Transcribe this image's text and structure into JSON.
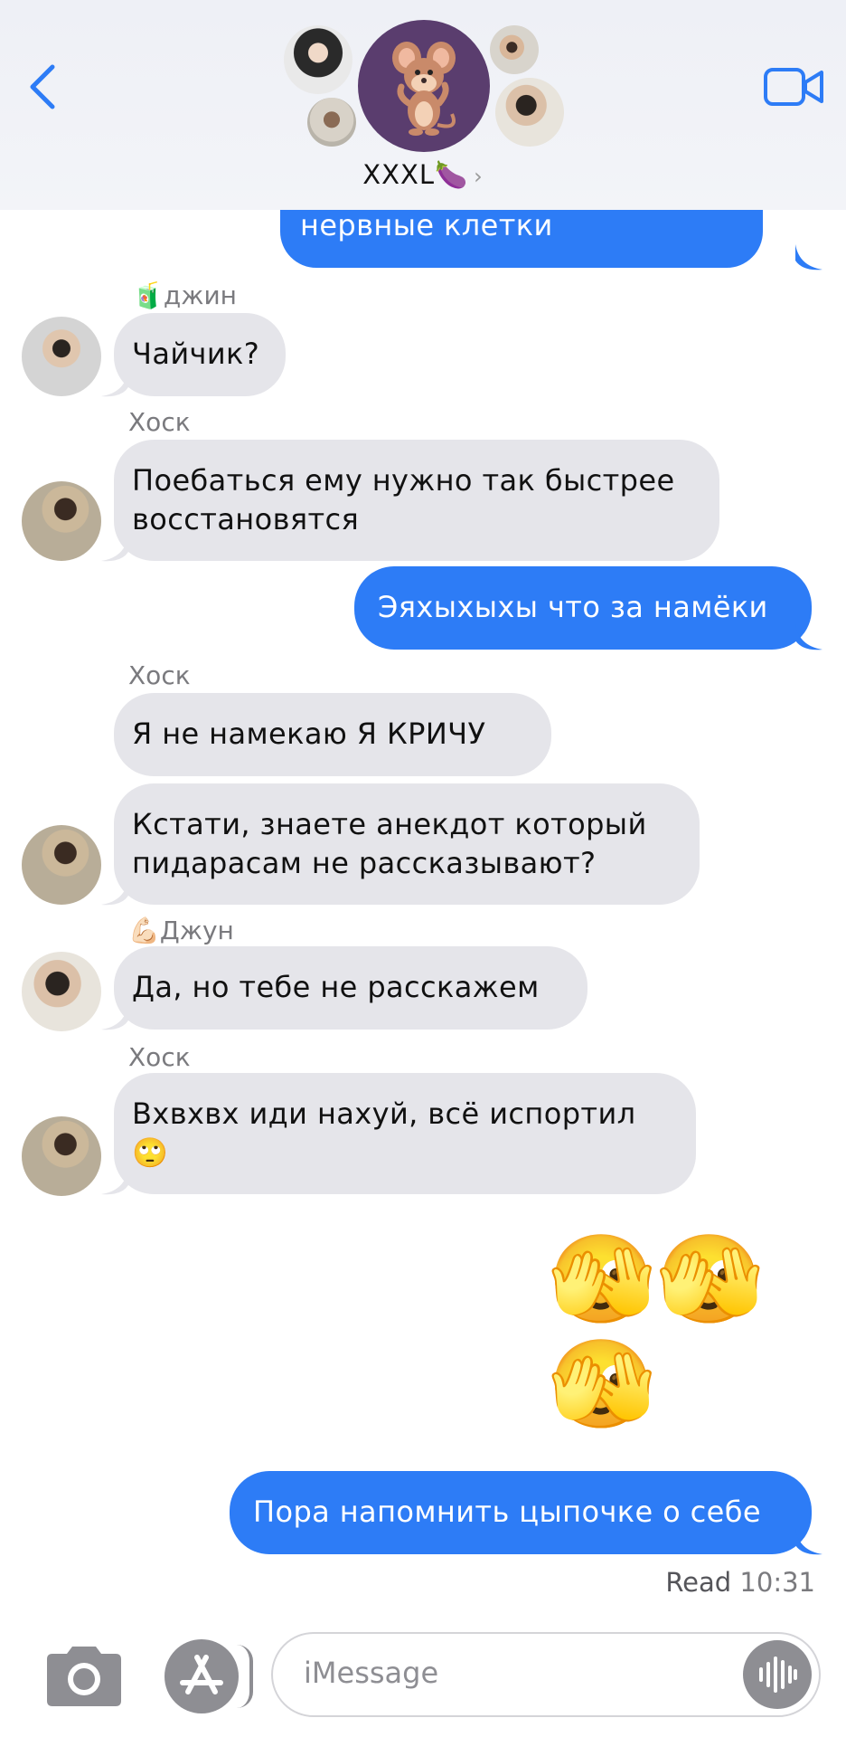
{
  "header": {
    "title": "XXXL🍆",
    "chevron": "›"
  },
  "messages": [
    {
      "id": "m0",
      "dir": "out",
      "text": "нервные клетки"
    },
    {
      "id": "m1",
      "dir": "in",
      "sender": "🧃джин",
      "text": "Чайчик?"
    },
    {
      "id": "m2",
      "dir": "in",
      "sender": "Хоск",
      "text": "Поебаться ему нужно так быстрее восстановятся"
    },
    {
      "id": "m3",
      "dir": "out",
      "text": "Эяхыхыхы что за намёки"
    },
    {
      "id": "m4",
      "dir": "in",
      "sender": "Хоск",
      "text": "Я не намекаю  Я КРИЧУ"
    },
    {
      "id": "m5",
      "dir": "in",
      "text": "Кстати,  знаете  анекдот который пидарасам не рассказывают?"
    },
    {
      "id": "m6",
      "dir": "in",
      "sender": "💪🏻Джун",
      "text": "Да, но тебе не расскажем"
    },
    {
      "id": "m7",
      "dir": "in",
      "sender": "Хоск",
      "text": "Вхвхвх иди нахуй,  всё  испортил 🙄"
    },
    {
      "id": "m8",
      "dir": "out",
      "text": "🫣🫣🫣"
    },
    {
      "id": "m9",
      "dir": "out",
      "text": "Пора напомнить  цыпочке о себе"
    }
  ],
  "status": {
    "read_label": "Read",
    "read_time": "10:31"
  },
  "composer": {
    "placeholder": "iMessage"
  },
  "colors": {
    "outgoing_bubble": "#2d7cf6",
    "incoming_bubble": "#e5e5ea",
    "accent": "#2d7cf6"
  },
  "icons": {
    "back": "chevron-left-icon",
    "video": "video-camera-icon",
    "camera": "camera-icon",
    "apps": "app-store-icon",
    "voice": "waveform-icon"
  }
}
